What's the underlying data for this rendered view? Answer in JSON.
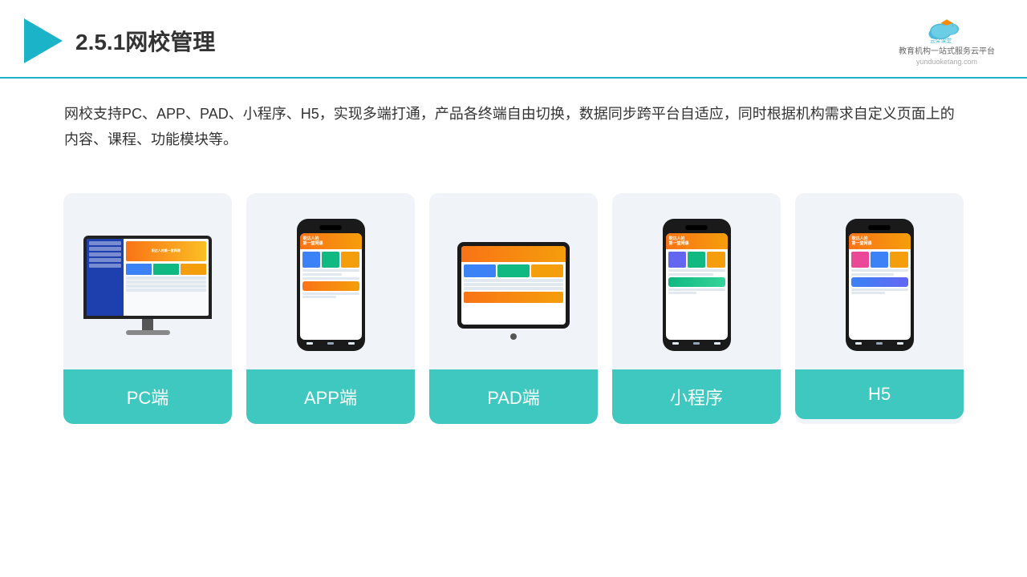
{
  "header": {
    "title": "2.5.1网校管理",
    "logo_name": "云朵课堂",
    "logo_subtitle": "教育机构一站\n式服务云平台",
    "logo_domain": "yunduoketang.com"
  },
  "description": {
    "text": "网校支持PC、APP、PAD、小程序、H5，实现多端打通，产品各终端自由切换，数据同步跨平台自适应，同时根据机构需求自定义页面上的内容、课程、功能模块等。"
  },
  "cards": [
    {
      "id": "pc",
      "label": "PC端"
    },
    {
      "id": "app",
      "label": "APP端"
    },
    {
      "id": "pad",
      "label": "PAD端"
    },
    {
      "id": "miniapp",
      "label": "小程序"
    },
    {
      "id": "h5",
      "label": "H5"
    }
  ],
  "colors": {
    "teal": "#3ec8c0",
    "accent_blue": "#1ab3c8",
    "bg_card": "#f0f4f8"
  }
}
